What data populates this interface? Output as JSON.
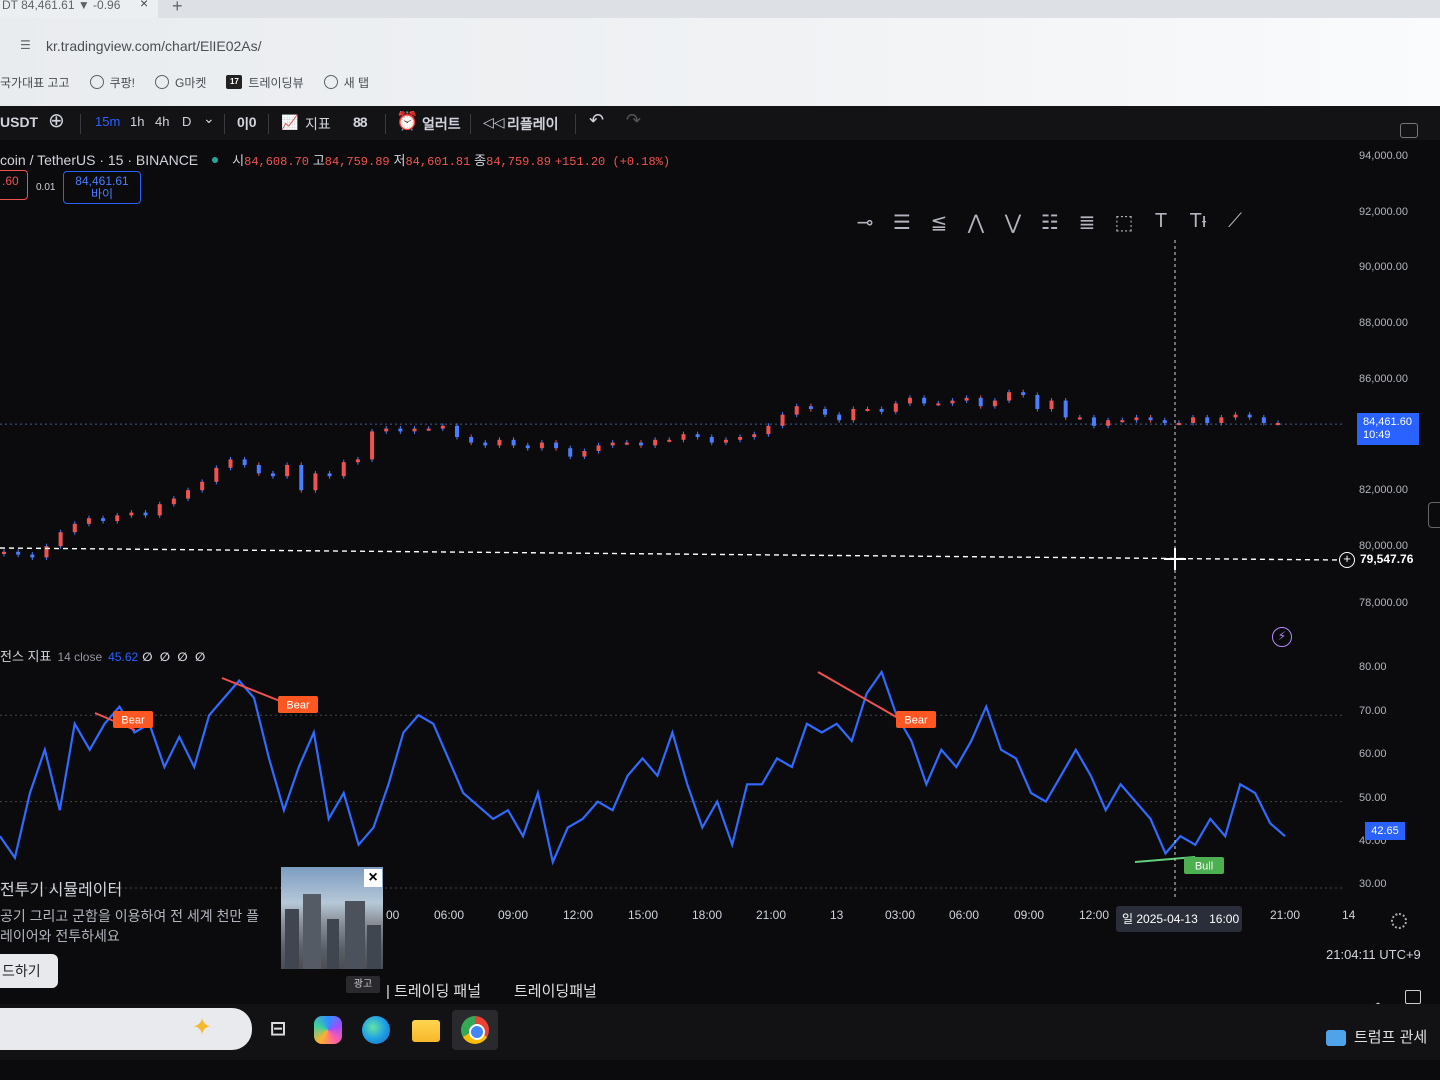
{
  "browser": {
    "tab_title": "DT 84,461.61 ▼ -0.96",
    "tab_close": "×",
    "new_tab": "+",
    "url": "kr.tradingview.com/chart/ElIE02As/",
    "bookmarks": [
      {
        "label": "국가대표 고고",
        "icon": "none"
      },
      {
        "label": "쿠팡!",
        "icon": "globe-icon"
      },
      {
        "label": "G마켓",
        "icon": "globe-icon"
      },
      {
        "label": "트레이딩뷰",
        "icon": "tradingview-icon"
      },
      {
        "label": "새 탭",
        "icon": "globe-icon"
      }
    ]
  },
  "toolbar": {
    "symbol": "USDT",
    "add_symbol": "⊕",
    "timeframes": [
      "15m",
      "1h",
      "4h",
      "D"
    ],
    "active_timeframe": "15m",
    "chevron": "⌄",
    "candle_icon": "0|0",
    "indicators_label": "지표",
    "layout_icon": "88",
    "alert_label": "얼러트",
    "replay_label": "리플레이",
    "undo": "↶",
    "redo": "↷"
  },
  "legend": {
    "symbol_text": "coin / TetherUS · 15 · BINANCE",
    "open_label": "시",
    "open": "84,608.70",
    "high_label": "고",
    "high": "84,759.89",
    "low_label": "저",
    "low": "84,601.81",
    "close_label": "종",
    "close": "84,759.89",
    "change": "+151.20 (+0.18%)",
    "sell_price": ".60",
    "spread": "0.01",
    "buy_price": "84,461.61",
    "buy_label": "바이"
  },
  "price_scale": {
    "ticks": [
      "94,000.00",
      "92,000.00",
      "90,000.00",
      "88,000.00",
      "86,000.00",
      "82,000.00",
      "80,000.00",
      "78,000.00"
    ],
    "current_price": "84,461.60",
    "countdown": "10:49",
    "crosshair_price": "79,547.76"
  },
  "rsi": {
    "name": "전스 지표",
    "params": "14 close",
    "value": "45.62",
    "na_values": "∅ ∅ ∅ ∅",
    "ticks": [
      "80.00",
      "70.00",
      "60.00",
      "50.00",
      "40.00",
      "30.00"
    ],
    "current": "42.65",
    "labels": {
      "bear": "Bear",
      "bull": "Bull"
    }
  },
  "time_axis": {
    "ticks": [
      "00",
      "06:00",
      "09:00",
      "12:00",
      "15:00",
      "18:00",
      "21:00",
      "13",
      "03:00",
      "06:00",
      "09:00",
      "12:00",
      "16:00",
      "21:00",
      "14"
    ],
    "cursor_label": "일 2025-04-13",
    "clock": "21:04:11 UTC+9"
  },
  "ad": {
    "title": "전투기 시뮬레이터",
    "body": "공기 그리고 군함을 이용하여 전 세계 천만 플레이어와 전투하세요",
    "button": "드하기",
    "close": "×",
    "ad_label": "광고"
  },
  "panels": {
    "tab1": "| 트레이딩 패널",
    "tab2": "트레이딩패널"
  },
  "taskbar": {
    "news": "트럼프 관세"
  },
  "chart_data": {
    "type": "line",
    "price_candles_close": [
      79900,
      79800,
      79700,
      80100,
      80600,
      80900,
      81100,
      81000,
      81200,
      81300,
      81200,
      81600,
      81800,
      82100,
      82400,
      82900,
      83200,
      83000,
      82700,
      82600,
      83000,
      82100,
      82700,
      82600,
      83100,
      83200,
      84200,
      84300,
      84200,
      84300,
      84300,
      84400,
      84000,
      83800,
      83700,
      83900,
      83700,
      83600,
      83800,
      83600,
      83300,
      83500,
      83700,
      83800,
      83800,
      83700,
      83900,
      83900,
      84100,
      84000,
      83800,
      83900,
      84000,
      84100,
      84400,
      84800,
      85100,
      85000,
      84800,
      84600,
      85000,
      85000,
      84900,
      85200,
      85400,
      85200,
      85200,
      85300,
      85400,
      85100,
      85300,
      85600,
      85500,
      85000,
      85300,
      84700,
      84700,
      84400,
      84600,
      84600,
      84700,
      84600,
      84500,
      84500,
      84700,
      84500,
      84700,
      84800,
      84700,
      84500,
      84500
    ],
    "rsi": [
      42,
      37,
      52,
      62,
      48,
      68,
      62,
      68,
      72,
      66,
      68,
      58,
      65,
      58,
      70,
      74,
      78,
      74,
      60,
      48,
      58,
      66,
      46,
      52,
      40,
      44,
      54,
      66,
      70,
      68,
      60,
      52,
      49,
      46,
      48,
      42,
      52,
      36,
      44,
      46,
      50,
      48,
      56,
      60,
      56,
      66,
      54,
      44,
      50,
      40,
      54,
      54,
      60,
      58,
      68,
      66,
      68,
      64,
      75,
      80,
      70,
      64,
      54,
      62,
      58,
      64,
      72,
      62,
      60,
      52,
      50,
      56,
      62,
      56,
      48,
      54,
      50,
      46,
      38,
      42,
      40,
      46,
      42,
      54,
      52,
      45,
      42
    ],
    "price_ylim": [
      77000,
      94500
    ],
    "rsi_ylim": [
      28,
      82
    ],
    "rsi_reference_lines": [
      70,
      50,
      30
    ],
    "annotations": [
      "Bear",
      "Bear",
      "Bear",
      "Bull"
    ],
    "last_price": 84461.6,
    "crosshair_price": 79547.76
  }
}
